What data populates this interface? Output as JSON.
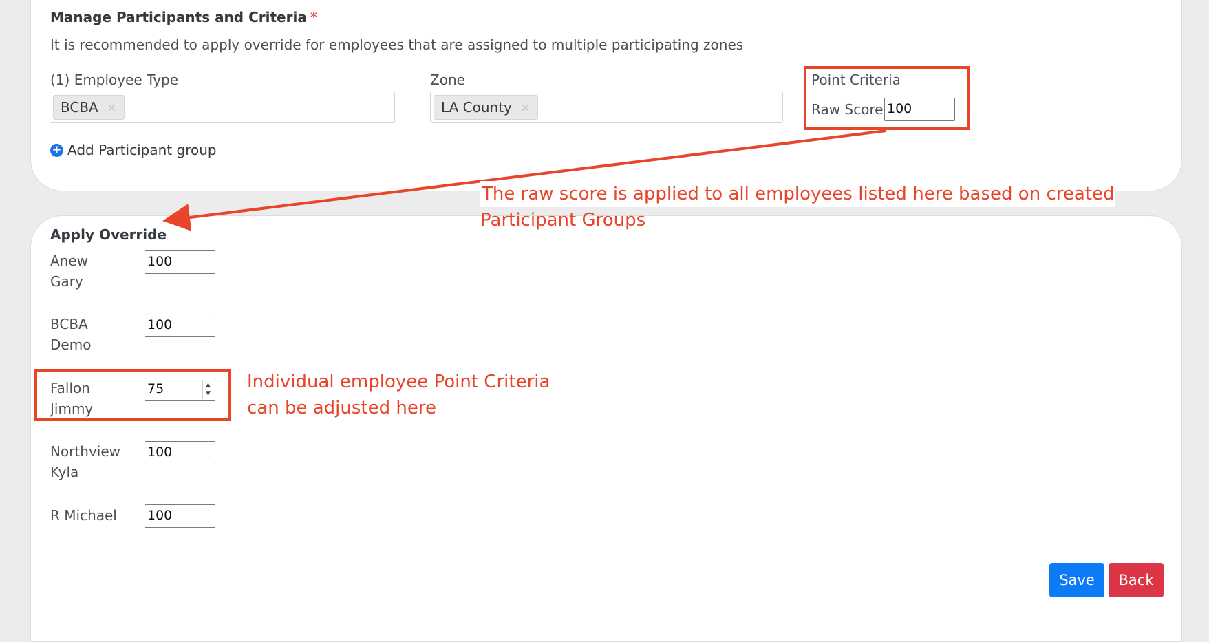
{
  "criteria_section": {
    "title": "Manage Participants and Criteria",
    "required_mark": "*",
    "hint": "It is recommended to apply override for employees that are assigned to multiple participating zones",
    "employee_type": {
      "label": "(1) Employee Type",
      "selected": [
        "BCBA"
      ],
      "remove_glyph": "×"
    },
    "zone": {
      "label": "Zone",
      "selected": [
        "LA County"
      ],
      "remove_glyph": "×"
    },
    "point_criteria": {
      "label": "Point Criteria",
      "raw_score_label": "Raw Score",
      "raw_score_value": "100"
    },
    "add_group": {
      "icon": "plus-circle-icon",
      "label": "Add Participant group"
    }
  },
  "override_section": {
    "title": "Apply Override",
    "employees": [
      {
        "first": "Anew",
        "last": "Gary",
        "value": "100"
      },
      {
        "first": "BCBA",
        "last": "Demo",
        "value": "100"
      },
      {
        "first": "Fallon",
        "last": "Jimmy",
        "value": "75"
      },
      {
        "first": "Northview",
        "last": "Kyla",
        "value": "100"
      },
      {
        "first": "R Michael",
        "last": "",
        "value": "100"
      }
    ]
  },
  "annotations": {
    "raw_score_note": [
      "The raw score is applied to all employees listed here based on created",
      "Participant Groups"
    ],
    "individual_note": [
      "Individual employee Point Criteria",
      "can be adjusted here"
    ],
    "color": "#e8452a"
  },
  "actions": {
    "save_label": "Save",
    "back_label": "Back",
    "save_color": "#0d7bf5",
    "back_color": "#dc3545"
  }
}
